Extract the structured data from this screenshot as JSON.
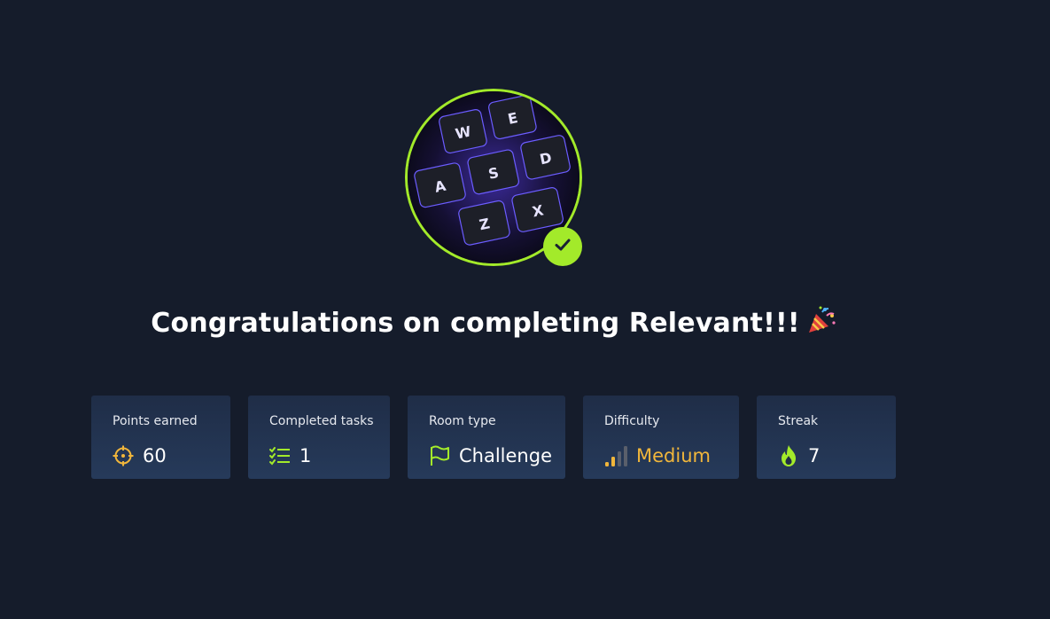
{
  "title": "Congratulations on completing Relevant!!!",
  "badge": {
    "image": "keyboard-wasd-keys",
    "status_icon": "check-icon",
    "accent": "#a3ea2a"
  },
  "stats": [
    {
      "label": "Points earned",
      "value": "60",
      "icon": "target-icon",
      "icon_color": "#f1b63b"
    },
    {
      "label": "Completed tasks",
      "value": "1",
      "icon": "checklist-icon",
      "icon_color": "#a3ea2a"
    },
    {
      "label": "Room type",
      "value": "Challenge",
      "icon": "flag-icon",
      "icon_color": "#a3ea2a"
    },
    {
      "label": "Difficulty",
      "value": "Medium",
      "icon": "signal-bars-icon",
      "icon_color": "#f1b63b",
      "level": 2,
      "max_level": 4
    },
    {
      "label": "Streak",
      "value": "7",
      "icon": "flame-icon",
      "icon_color": "#a3ea2a"
    }
  ],
  "colors": {
    "background": "#151c2b",
    "card": "#223250",
    "accent_green": "#a3ea2a",
    "accent_orange": "#f1b63b"
  }
}
